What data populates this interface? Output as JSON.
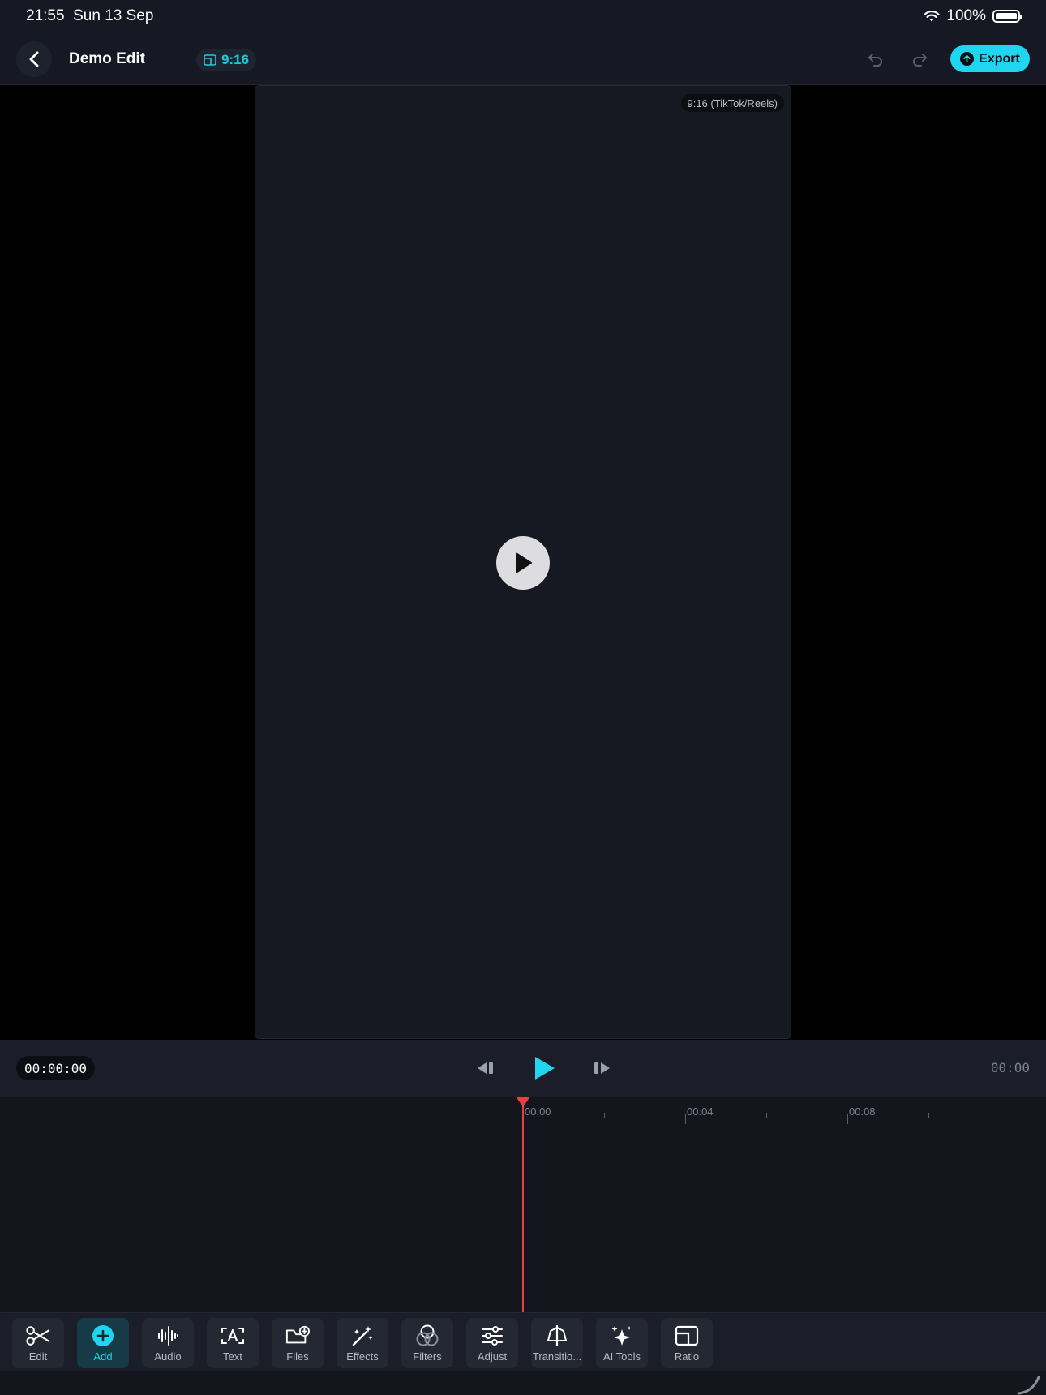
{
  "status": {
    "time": "21:55",
    "date": "Sun 13 Sep",
    "battery": "100%"
  },
  "header": {
    "title": "Demo Edit",
    "ratio": "9:16",
    "export_label": "Export"
  },
  "preview": {
    "badge": "9:16 (TikTok/Reels)"
  },
  "transport": {
    "timecode": "00:00:00",
    "duration": "00:00"
  },
  "timeline": {
    "ticks": [
      "00:00",
      "00:04",
      "00:08"
    ]
  },
  "toolbar": [
    {
      "label": "Edit",
      "icon": "scissors-icon"
    },
    {
      "label": "Add",
      "icon": "plus-circle-icon",
      "active": true
    },
    {
      "label": "Audio",
      "icon": "waveform-icon"
    },
    {
      "label": "Text",
      "icon": "text-box-icon"
    },
    {
      "label": "Files",
      "icon": "folder-plus-icon"
    },
    {
      "label": "Effects",
      "icon": "magic-wand-icon"
    },
    {
      "label": "Filters",
      "icon": "filters-icon"
    },
    {
      "label": "Adjust",
      "icon": "sliders-icon"
    },
    {
      "label": "Transitio...",
      "icon": "transition-icon"
    },
    {
      "label": "AI Tools",
      "icon": "sparkles-icon"
    },
    {
      "label": "Ratio",
      "icon": "ratio-icon"
    }
  ],
  "colors": {
    "accent": "#1fd5ef",
    "playhead": "#e84040",
    "background": "#14161e"
  }
}
